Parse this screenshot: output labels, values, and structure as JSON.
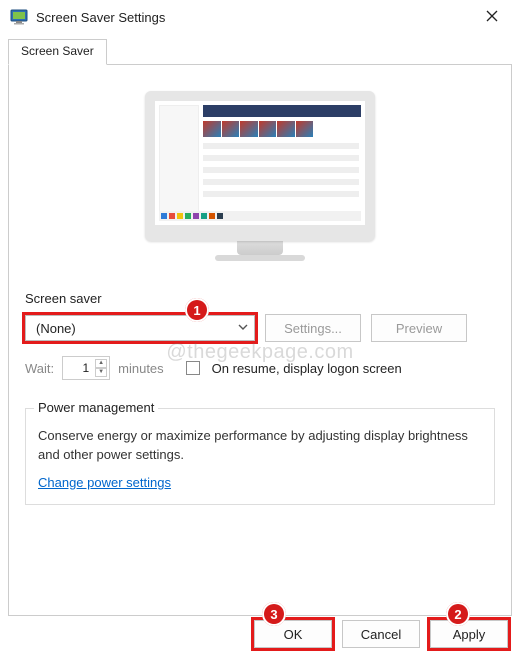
{
  "window": {
    "title": "Screen Saver Settings"
  },
  "tabs": [
    {
      "label": "Screen Saver"
    }
  ],
  "screensaver": {
    "section_label": "Screen saver",
    "dropdown_value": "(None)",
    "settings_button": "Settings...",
    "preview_button": "Preview",
    "wait_label": "Wait:",
    "wait_value": "1",
    "wait_unit": "minutes",
    "resume_checkbox_label": "On resume, display logon screen",
    "resume_checked": false,
    "settings_enabled": false,
    "preview_enabled": false,
    "wait_enabled": false
  },
  "power": {
    "legend": "Power management",
    "description": "Conserve energy or maximize performance by adjusting display brightness and other power settings.",
    "link": "Change power settings"
  },
  "buttons": {
    "ok": "OK",
    "cancel": "Cancel",
    "apply": "Apply"
  },
  "watermark": "@thegeekpage.com",
  "annotations": {
    "badge1": "1",
    "badge2": "2",
    "badge3": "3"
  }
}
